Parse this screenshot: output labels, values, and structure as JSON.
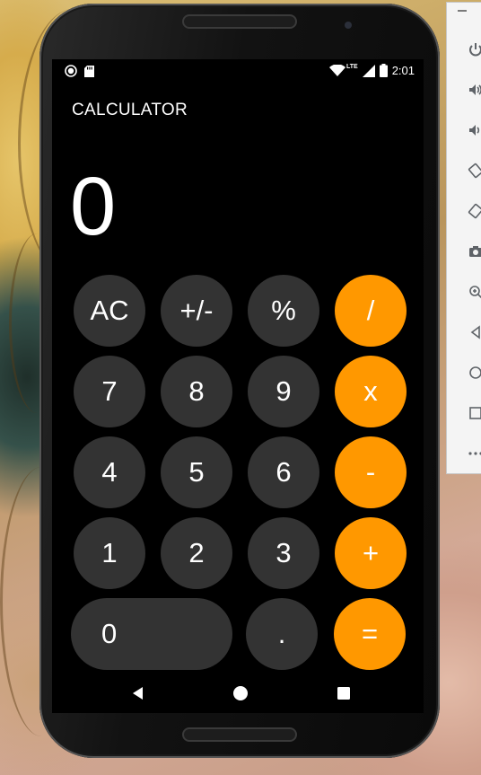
{
  "app": {
    "title": "CALCULATOR"
  },
  "status_bar": {
    "time": "2:01",
    "network_label": "LTE"
  },
  "display": {
    "value": "0"
  },
  "keypad": {
    "rows": [
      [
        "AC",
        "+/-",
        "%",
        "/"
      ],
      [
        "7",
        "8",
        "9",
        "x"
      ],
      [
        "4",
        "5",
        "6",
        "-"
      ],
      [
        "1",
        "2",
        "3",
        "+"
      ],
      [
        "0",
        ".",
        "="
      ]
    ]
  },
  "nav_bar": {
    "icons": [
      "back-icon",
      "home-icon",
      "recents-icon"
    ]
  },
  "emulator_toolbar": {
    "icons": [
      "minimize-icon",
      "power-icon",
      "volume-up-icon",
      "volume-down-icon",
      "rotate-left-icon",
      "rotate-right-icon",
      "camera-icon",
      "zoom-icon",
      "back-icon",
      "home-icon",
      "overview-icon",
      "more-icon"
    ]
  },
  "colors": {
    "number_key": "#333333",
    "operator_key": "#ff9800",
    "screen_background": "#000000",
    "text": "#ffffff"
  }
}
